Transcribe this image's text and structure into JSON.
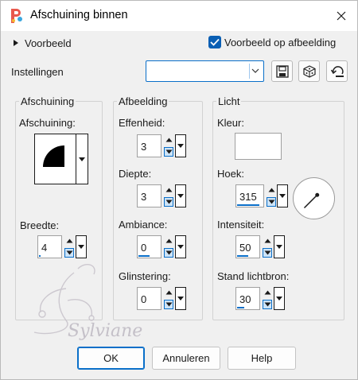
{
  "window": {
    "title": "Afschuining binnen"
  },
  "preview": {
    "toggle_label": "Voorbeeld",
    "checkbox_label": "Voorbeeld op afbeelding",
    "checkbox_checked": true
  },
  "settings": {
    "label": "Instellingen",
    "preset_value": ""
  },
  "groups": {
    "bevel": {
      "title": "Afschuining",
      "shape_label": "Afschuining:",
      "width_label": "Breedte:",
      "width_value": "4",
      "width_fraction": 0.04
    },
    "image": {
      "title": "Afbeelding",
      "smoothness_label": "Effenheid:",
      "smoothness_value": "3",
      "depth_label": "Diepte:",
      "depth_value": "3",
      "ambience_label": "Ambiance:",
      "ambience_value": "0",
      "ambience_fraction": 0.5,
      "shininess_label": "Glinstering:",
      "shininess_value": "0"
    },
    "light": {
      "title": "Licht",
      "color_label": "Kleur:",
      "color_hex": "#ffffff",
      "angle_label": "Hoek:",
      "angle_value": "315",
      "angle_fraction": 0.875,
      "intensity_label": "Intensiteit:",
      "intensity_value": "50",
      "intensity_fraction": 0.5,
      "elevation_label": "Stand lichtbron:",
      "elevation_value": "30",
      "elevation_fraction": 0.33
    }
  },
  "buttons": {
    "ok": "OK",
    "cancel": "Annuleren",
    "help": "Help"
  },
  "watermark": {
    "text": "Sylviane"
  },
  "colors": {
    "accent": "#0a6fc9",
    "checkbox": "#0a5fb4"
  },
  "icons": {
    "app": "app-logo-icon",
    "close": "close-icon",
    "expand": "triangle-right-icon",
    "save": "save-icon",
    "random": "random-dice-icon",
    "reset": "reset-icon"
  }
}
